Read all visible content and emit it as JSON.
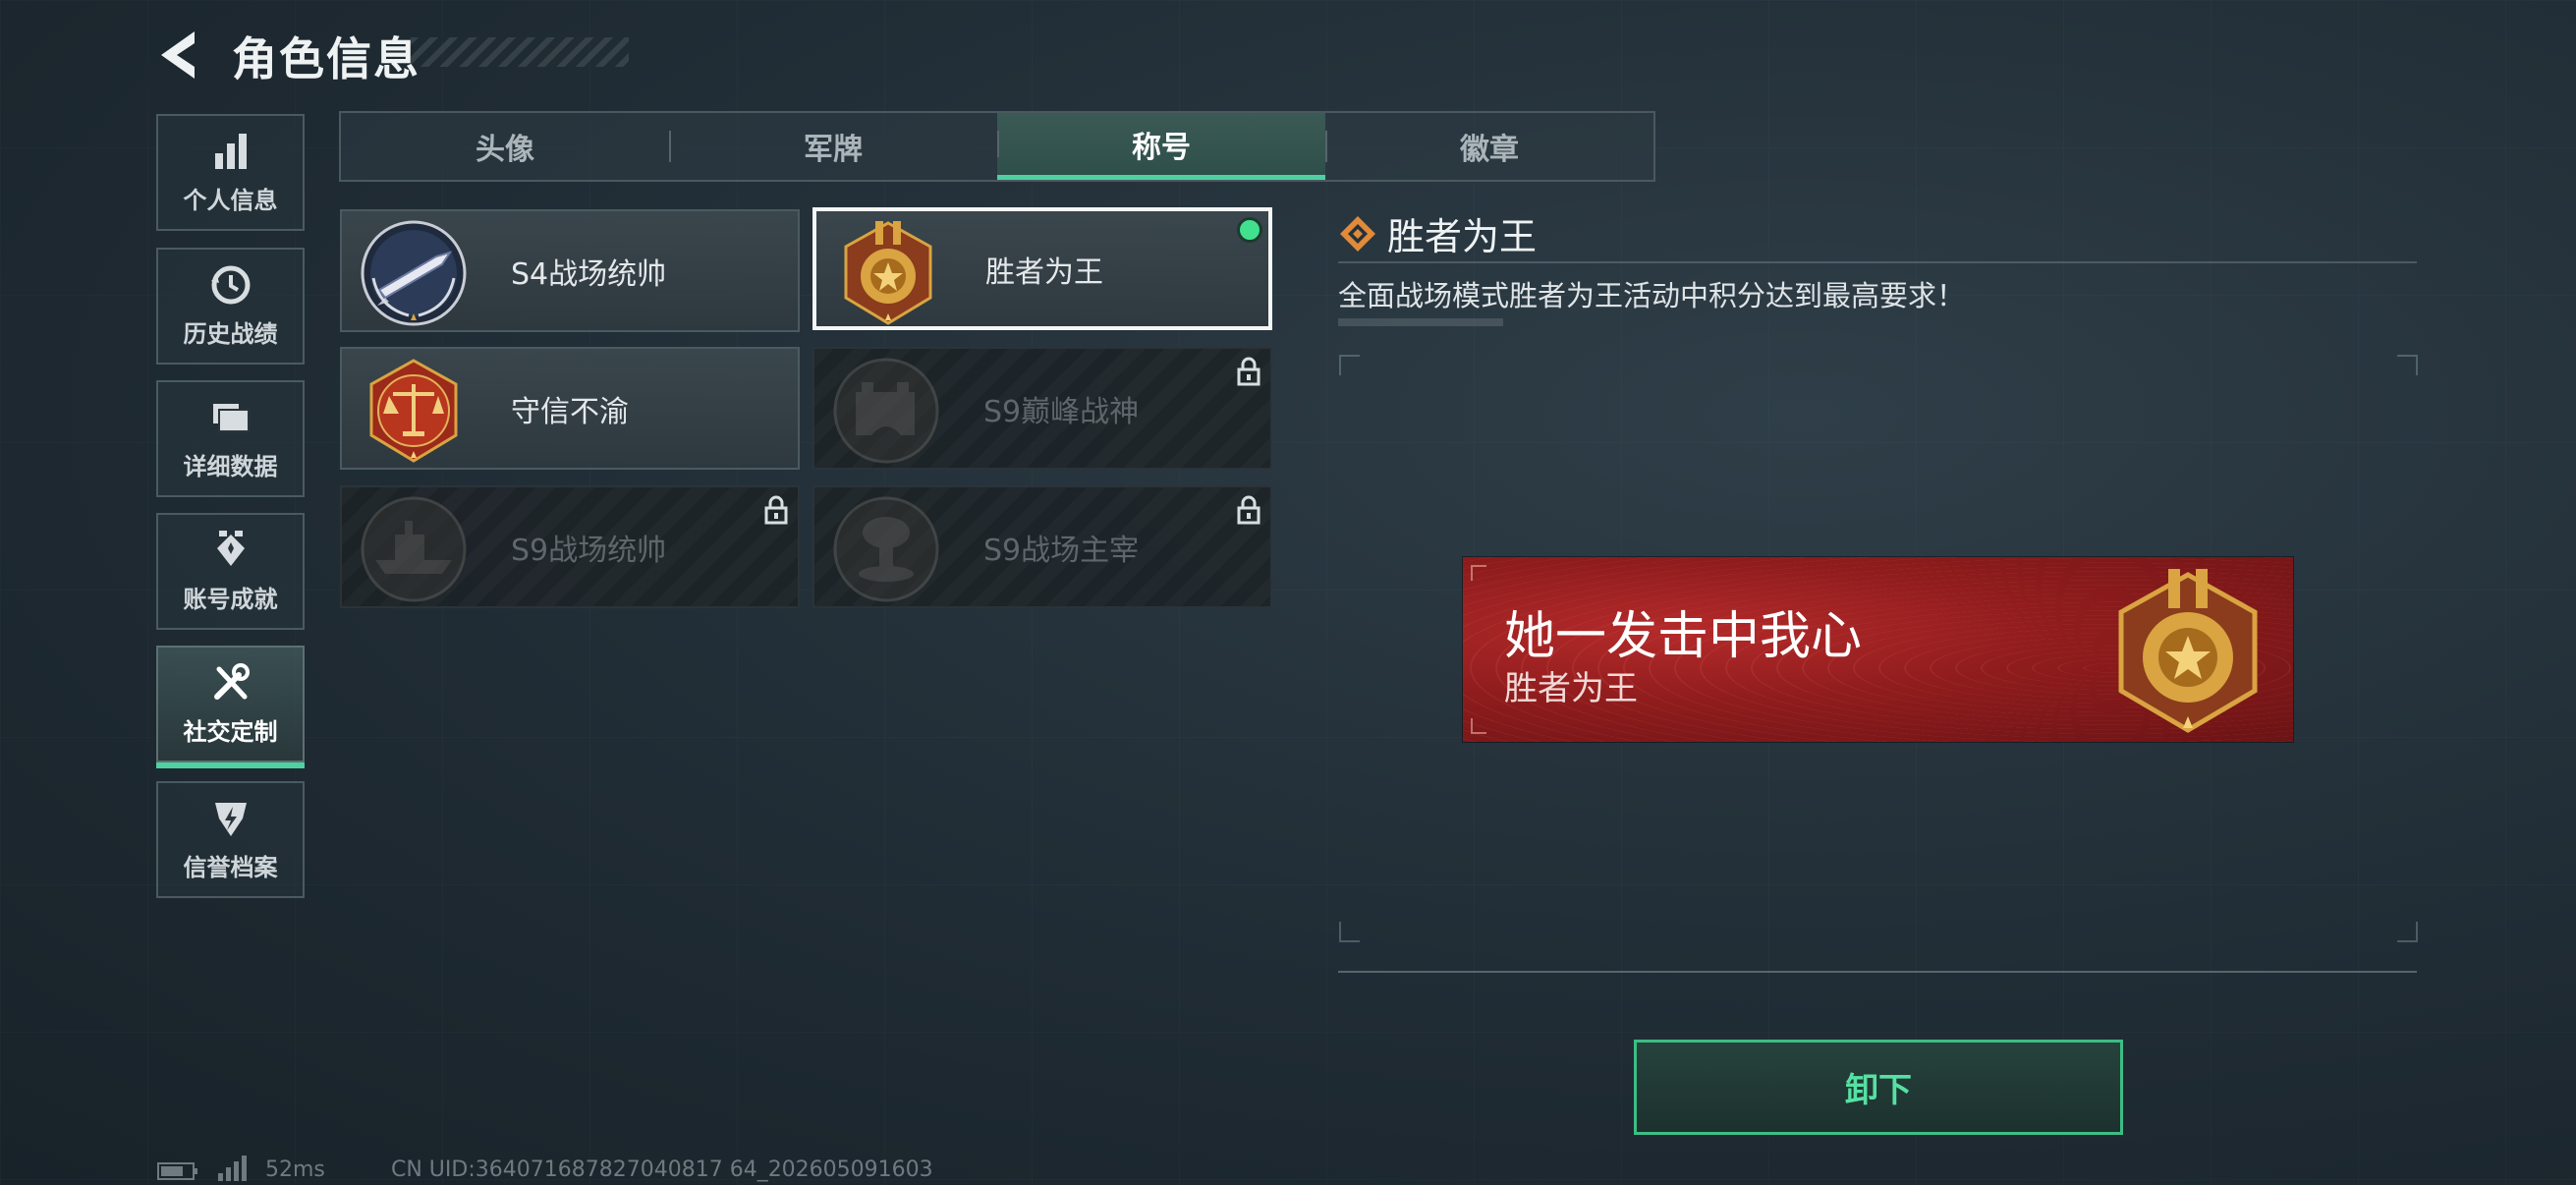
{
  "header": {
    "title": "角色信息"
  },
  "sidebar": {
    "items": [
      {
        "label": "个人信息",
        "icon": "bar-chart-icon"
      },
      {
        "label": "历史战绩",
        "icon": "history-clock-icon"
      },
      {
        "label": "详细数据",
        "icon": "folder-icon"
      },
      {
        "label": "账号成就",
        "icon": "achievement-icon"
      },
      {
        "label": "社交定制",
        "icon": "tools-icon",
        "active": true
      },
      {
        "label": "信誉档案",
        "icon": "credit-badge-icon"
      }
    ]
  },
  "tabs": [
    {
      "label": "头像"
    },
    {
      "label": "军牌"
    },
    {
      "label": "称号",
      "active": true
    },
    {
      "label": "徽章"
    }
  ],
  "titles": [
    {
      "name": "S4战场统帅",
      "locked": false,
      "selected": false,
      "emblem": "missile-emblem-icon"
    },
    {
      "name": "胜者为王",
      "locked": false,
      "selected": true,
      "emblem": "gold-medal-emblem-icon"
    },
    {
      "name": "守信不渝",
      "locked": false,
      "selected": false,
      "emblem": "scales-emblem-icon"
    },
    {
      "name": "S9巅峰战神",
      "locked": true,
      "selected": false,
      "emblem": "fortress-emblem-icon"
    },
    {
      "name": "S9战场统帅",
      "locked": true,
      "selected": false,
      "emblem": "warship-emblem-icon"
    },
    {
      "name": "S9战场主宰",
      "locked": true,
      "selected": false,
      "emblem": "explosion-emblem-icon"
    }
  ],
  "detail": {
    "title": "胜者为王",
    "description": "全面战场模式胜者为王活动中积分达到最高要求！"
  },
  "banner": {
    "main_text": "她一发击中我心",
    "sub_text": "胜者为王"
  },
  "actions": {
    "unequip_label": "卸下"
  },
  "footer": {
    "ping": "52ms",
    "uid": "CN UID:364071687827040817 64_202605091603"
  },
  "colors": {
    "accent": "#4fd0a0",
    "banner_red": "#9c2022",
    "gold": "#d9a441"
  }
}
